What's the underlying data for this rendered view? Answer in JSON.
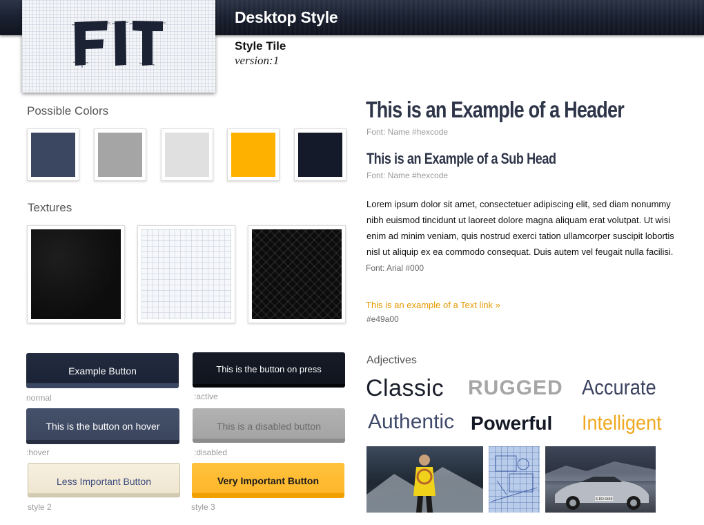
{
  "header": {
    "title": "Desktop Style",
    "subtitle": "Style Tile",
    "version": "version:1",
    "logo_text": "FIT"
  },
  "colors": {
    "heading": "Possible Colors",
    "swatches": [
      {
        "name": "slate-blue",
        "hex": "#3b4661"
      },
      {
        "name": "medium-gray",
        "hex": "#a5a5a5"
      },
      {
        "name": "light-gray",
        "hex": "#e0e0e0"
      },
      {
        "name": "amber",
        "hex": "#ffb100"
      },
      {
        "name": "midnight-navy",
        "hex": "#141a2a"
      }
    ]
  },
  "textures": {
    "heading": "Textures",
    "items": [
      "black-leather",
      "light-graph-grid",
      "black-diamond-weave"
    ]
  },
  "buttons": {
    "normal": {
      "label": "Example Button",
      "caption": "normal"
    },
    "active": {
      "label": "This is the button on press",
      "caption": ":active"
    },
    "hover": {
      "label": "This is the button on hover",
      "caption": ":hover"
    },
    "disabled": {
      "label": "This is a disabled button",
      "caption": ":disabled"
    },
    "style2": {
      "label": "Less Important Button",
      "caption": "style 2"
    },
    "style3": {
      "label": "Very Important Button",
      "caption": "style 3"
    }
  },
  "typography": {
    "header": "This is an Example of a Header",
    "header_font": "Font: Name #hexcode",
    "subhead": "This is an Example of a Sub Head",
    "subhead_font": "Font: Name #hexcode",
    "body": "Lorem ipsum dolor sit amet, consectetuer adipiscing elit, sed diam nonummy nibh euismod tincidunt ut laoreet dolore magna aliquam erat volutpat. Ut wisi enim ad minim veniam, quis nostrud exerci tation ullamcorper suscipit lobortis nisl ut aliquip ex ea commodo consequat. Duis autem vel feugait nulla facilisi.",
    "body_font": "Font: Arial #000",
    "link": "This is an example of a Text link »",
    "link_color": "#e49a00",
    "link_hex_label": "#e49a00"
  },
  "adjectives": {
    "heading": "Adjectives",
    "words": [
      "Classic",
      "RUGGED",
      "Accurate",
      "Authentic",
      "Powerful",
      "Intelligent"
    ]
  },
  "photos": [
    "mountain-climber",
    "blueprint",
    "convertible-car"
  ],
  "photo_text": {
    "plate": "S-DD 6439"
  }
}
